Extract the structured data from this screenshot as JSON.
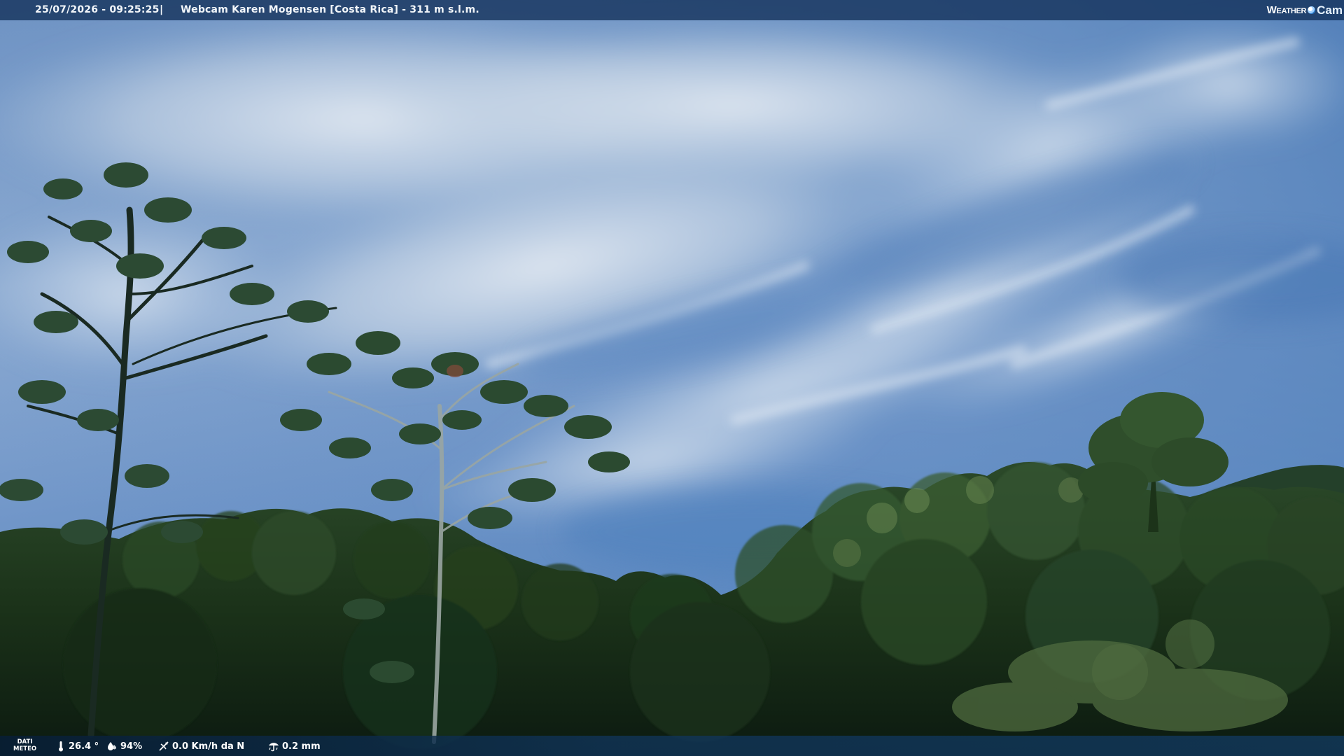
{
  "header": {
    "datetime": "25/07/2026 - 09:25:25",
    "separator": "|",
    "camera_label": "Webcam Karen Mogensen [Costa Rica]  - 311 m s.l.m."
  },
  "brand": {
    "word1": "Weather",
    "word2": "Cam",
    "icon": "globe-icon"
  },
  "meteo": {
    "label_line1": "DATI",
    "label_line2": "METEO",
    "temperature": "26.4 °",
    "humidity": "94%",
    "wind": "0.0 Km/h da N",
    "rain": "0.2 mm",
    "icons": {
      "temperature": "thermometer-icon",
      "humidity": "humidity-drop-icon",
      "wind": "wind-icon",
      "rain": "rain-icon"
    }
  },
  "colors": {
    "sky_top": "#5d87bd",
    "sky_mid": "#8aaed6",
    "cloud": "#d9e3ee",
    "forest_dark": "#0e2014",
    "forest_mid": "#223b20",
    "foliage_light": "#5f7a48",
    "overlay_bar": "#123058"
  }
}
